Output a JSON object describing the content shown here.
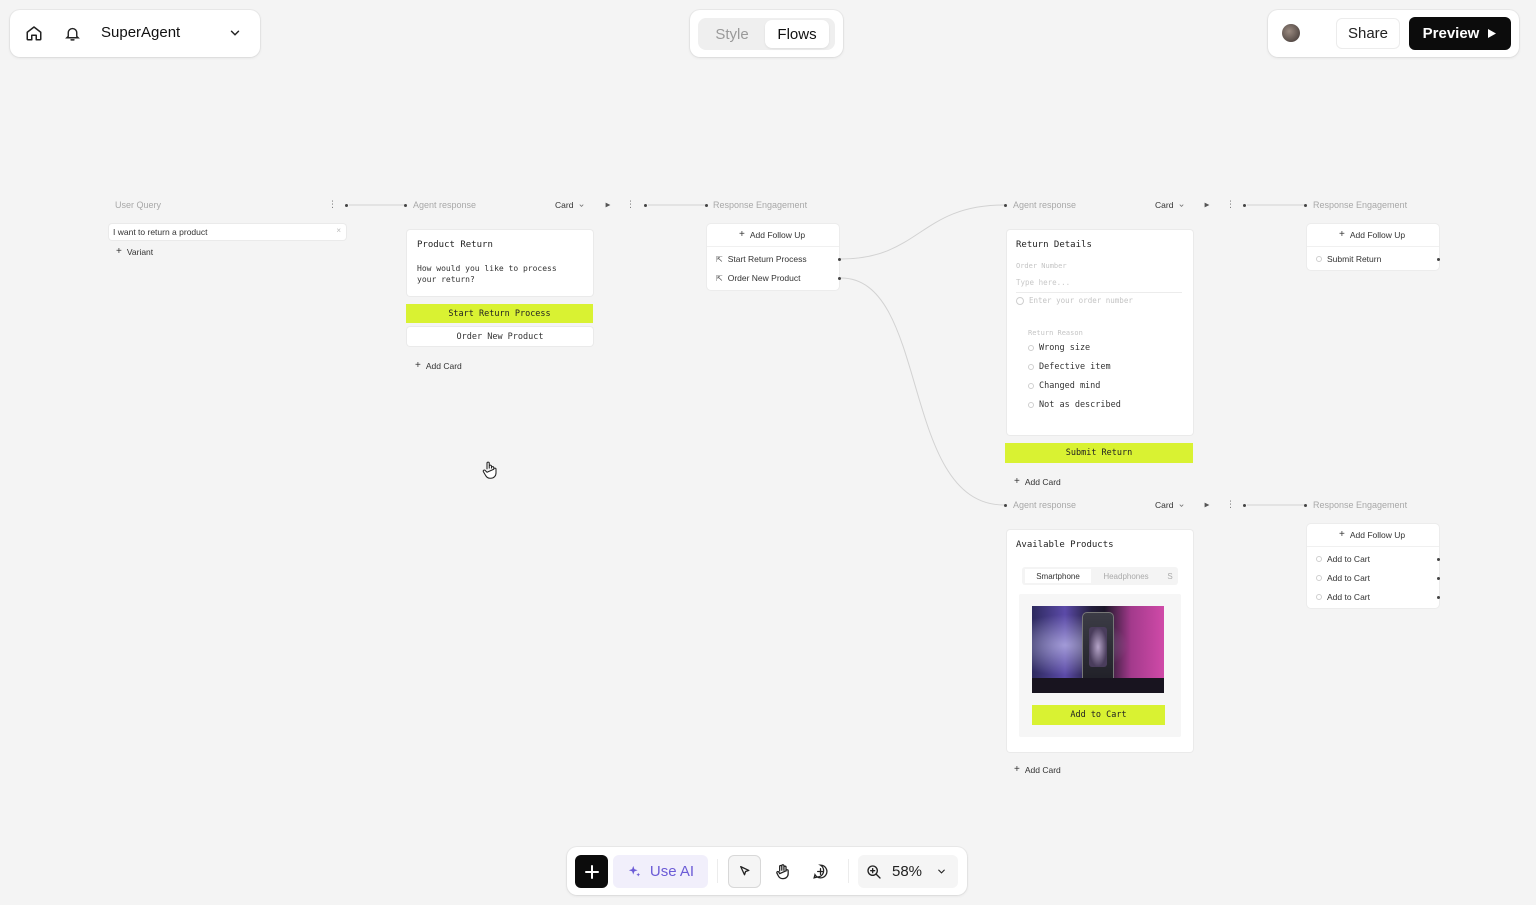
{
  "topbar": {
    "project_name": "SuperAgent",
    "tabs": [
      "Style",
      "Flows"
    ],
    "active_tab": "Flows",
    "share_label": "Share",
    "preview_label": "Preview"
  },
  "canvas": {
    "user_query": {
      "header": "User Query",
      "query_text": "I want to return a product",
      "variant_label": "Variant"
    },
    "agent_response_1": {
      "header": "Agent response",
      "type_label": "Card",
      "card_title": "Product Return",
      "card_body": "How would you like to process your return?",
      "primary_button": "Start Return Process",
      "secondary_button": "Order New Product",
      "add_card": "Add Card"
    },
    "engagement_1": {
      "header": "Response Engagement",
      "add_follow_up": "Add Follow Up",
      "items": [
        "Start Return Process",
        "Order New Product"
      ]
    },
    "agent_response_2": {
      "header": "Agent response",
      "type_label": "Card",
      "card_title": "Return Details",
      "order_number_label": "Order Number",
      "order_number_placeholder": "Type here...",
      "order_hint": "Enter your order number",
      "reason_label": "Return Reason",
      "reasons": [
        "Wrong size",
        "Defective item",
        "Changed mind",
        "Not as described"
      ],
      "submit_button": "Submit Return",
      "add_card": "Add Card"
    },
    "engagement_2": {
      "header": "Response Engagement",
      "add_follow_up": "Add Follow Up",
      "items": [
        "Submit Return"
      ]
    },
    "agent_response_3": {
      "header": "Agent response",
      "type_label": "Card",
      "card_title": "Available Products",
      "product_tabs": [
        "Smartphone",
        "Headphones",
        "S"
      ],
      "add_to_cart_button": "Add to Cart",
      "add_card": "Add Card"
    },
    "engagement_3": {
      "header": "Response Engagement",
      "add_follow_up": "Add Follow Up",
      "items": [
        "Add to Cart",
        "Add to Cart",
        "Add to Cart"
      ]
    }
  },
  "toolbar": {
    "use_ai_label": "Use AI",
    "zoom_label": "58%"
  },
  "colors": {
    "accent_lime": "#d9f232",
    "dark": "#0c0c0c",
    "ai_purple": "#6b5bd6"
  },
  "icons": [
    "home-icon",
    "bell-icon",
    "chevron-down-icon",
    "play-icon",
    "plus-icon",
    "sparkles-icon",
    "pointer-icon",
    "hand-icon",
    "comment-add-icon",
    "zoom-icon",
    "more-icon",
    "link-icon"
  ]
}
